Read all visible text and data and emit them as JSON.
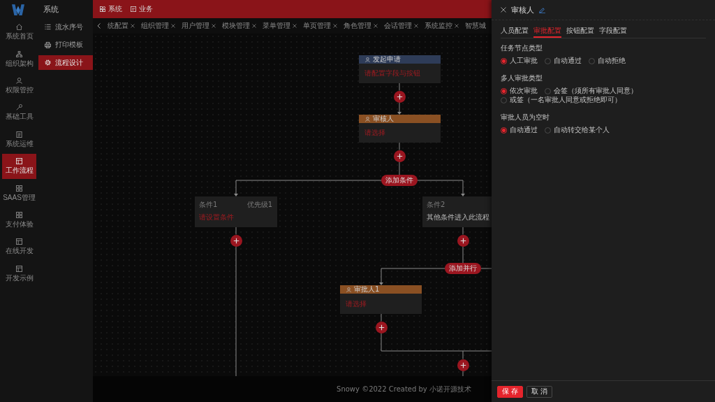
{
  "rail": {
    "items": [
      {
        "label": "系统首页",
        "selected": false
      },
      {
        "label": "组织架构",
        "selected": false
      },
      {
        "label": "权限管控",
        "selected": false
      },
      {
        "label": "基础工具",
        "selected": false
      },
      {
        "label": "系统运维",
        "selected": false
      },
      {
        "label": "工作流程",
        "selected": true
      },
      {
        "label": "SAAS管理",
        "selected": false
      },
      {
        "label": "支付体验",
        "selected": false
      },
      {
        "label": "在线开发",
        "selected": false
      },
      {
        "label": "开发示例",
        "selected": false
      }
    ]
  },
  "sidebar": {
    "title": "系统",
    "items": [
      {
        "label": "流水序号",
        "selected": false
      },
      {
        "label": "打印模板",
        "selected": false
      },
      {
        "label": "流程设计",
        "selected": true
      }
    ]
  },
  "top_bar": {
    "items": [
      {
        "label": "系统"
      },
      {
        "label": "业务"
      }
    ]
  },
  "tabs": [
    {
      "label": "统配置",
      "closable": true
    },
    {
      "label": "组织管理",
      "closable": true
    },
    {
      "label": "用户管理",
      "closable": true
    },
    {
      "label": "模块管理",
      "closable": true
    },
    {
      "label": "菜单管理",
      "closable": true
    },
    {
      "label": "单页管理",
      "closable": true
    },
    {
      "label": "角色管理",
      "closable": true
    },
    {
      "label": "会话管理",
      "closable": true
    },
    {
      "label": "系统监控",
      "closable": true
    },
    {
      "label": "智慧城",
      "closable": false
    }
  ],
  "flow": {
    "nodes": [
      {
        "kind": "start",
        "title": "发起申请",
        "content": "请配置字段与按钮",
        "configured": false
      },
      {
        "kind": "approver",
        "title": "审核人",
        "content": "请选择",
        "configured": false
      }
    ],
    "branch": {
      "button": "添加条件",
      "conditions": [
        {
          "title": "条件1",
          "priority": "优先级1",
          "content": "请设置条件",
          "configured": false
        },
        {
          "title": "条件2",
          "content": "其他条件进入此流程",
          "configured": true,
          "parallel": {
            "button": "添加并行",
            "nodes": [
              {
                "kind": "approver",
                "title": "审批人1",
                "content": "请选择",
                "configured": false
              }
            ]
          }
        }
      ]
    }
  },
  "footer": {
    "text": "Snowy ©2022 Created by 小诺开源技术"
  },
  "drawer": {
    "title": "审核人",
    "tabs": [
      {
        "label": "人员配置",
        "selected": false
      },
      {
        "label": "审批配置",
        "selected": true
      },
      {
        "label": "按钮配置",
        "selected": false
      },
      {
        "label": "字段配置",
        "selected": false
      }
    ],
    "sections": [
      {
        "label": "任务节点类型",
        "options": [
          {
            "label": "人工审批",
            "selected": true
          },
          {
            "label": "自动通过",
            "selected": false
          },
          {
            "label": "自动拒绝",
            "selected": false
          }
        ]
      },
      {
        "label": "多人审批类型",
        "options": [
          {
            "label": "依次审批",
            "selected": true
          },
          {
            "label": "会签（须所有审批人同意）",
            "selected": false
          },
          {
            "label": "或签（一名审批人同意或拒绝即可）",
            "selected": false
          }
        ]
      },
      {
        "label": "审批人员为空时",
        "options": [
          {
            "label": "自动通过",
            "selected": true
          },
          {
            "label": "自动转交给某个人",
            "selected": false
          }
        ]
      }
    ],
    "buttons": [
      {
        "label": "保 存",
        "kind": "primary"
      },
      {
        "label": "取 消",
        "kind": "default"
      }
    ]
  }
}
